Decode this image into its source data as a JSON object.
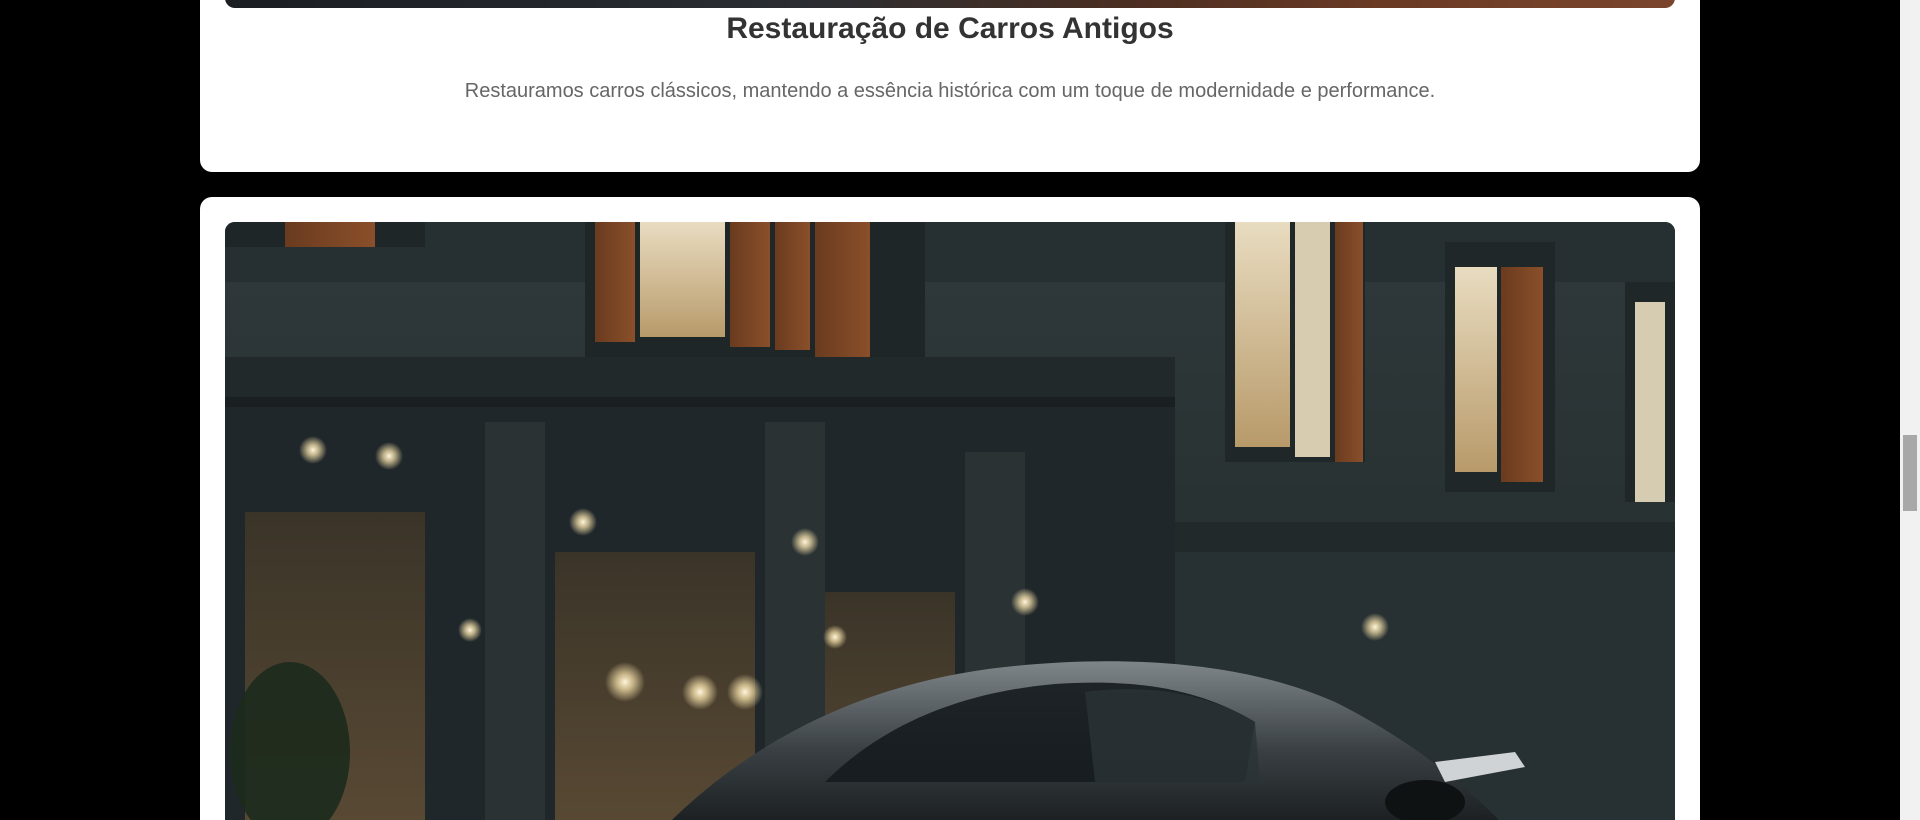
{
  "service_card": {
    "title": "Restauração de Carros Antigos",
    "description": "Restauramos carros clássicos, mantendo a essência histórica com um toque de modernidade e performance."
  },
  "next_card": {
    "image_subject": "sports-car-photo"
  },
  "colors": {
    "page_background": "#000000",
    "card_background": "#ffffff",
    "title_text": "#333333",
    "description_text": "#666666"
  }
}
